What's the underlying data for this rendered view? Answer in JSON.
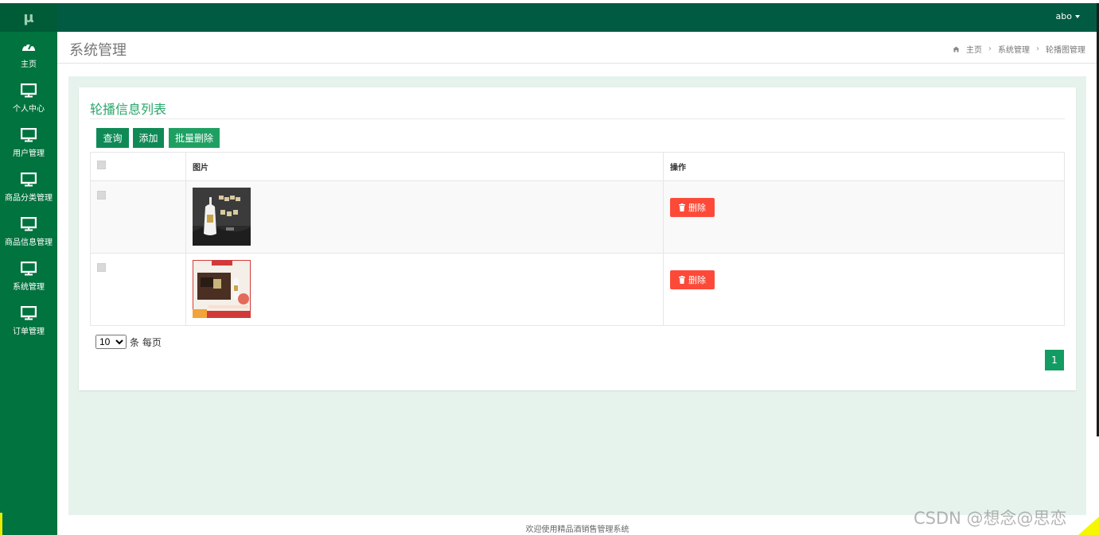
{
  "sidebar": {
    "logo": "μ",
    "items": [
      {
        "label": "主页",
        "icon": "dashboard-icon"
      },
      {
        "label": "个人中心",
        "icon": "monitor-icon"
      },
      {
        "label": "用户管理",
        "icon": "monitor-icon"
      },
      {
        "label": "商品分类管理",
        "icon": "monitor-icon"
      },
      {
        "label": "商品信息管理",
        "icon": "monitor-icon"
      },
      {
        "label": "系统管理",
        "icon": "monitor-icon"
      },
      {
        "label": "订单管理",
        "icon": "monitor-icon"
      }
    ]
  },
  "topbar": {
    "user": "abo"
  },
  "header": {
    "title": "系统管理",
    "breadcrumb": [
      "主页",
      "系统管理",
      "轮播图管理"
    ]
  },
  "card": {
    "title": "轮播信息列表",
    "buttons": {
      "query": "查询",
      "add": "添加",
      "batch_delete": "批量删除"
    },
    "table": {
      "headers": [
        "",
        "图片",
        "操作"
      ],
      "rows": [
        {
          "image": "liquor-bottle-image",
          "action": "删除"
        },
        {
          "image": "product-gift-box-image",
          "action": "删除"
        }
      ]
    },
    "pager": {
      "page_size": "10",
      "page_size_suffix": "条 每页",
      "current_page": "1"
    }
  },
  "footer": {
    "text": "欢迎使用精品酒销售管理系统"
  },
  "watermark": "CSDN @想念@思恋",
  "colors": {
    "sidebar": "#00733e",
    "topbar": "#005b42",
    "accent": "#28a66a",
    "danger": "#fd4a38"
  }
}
